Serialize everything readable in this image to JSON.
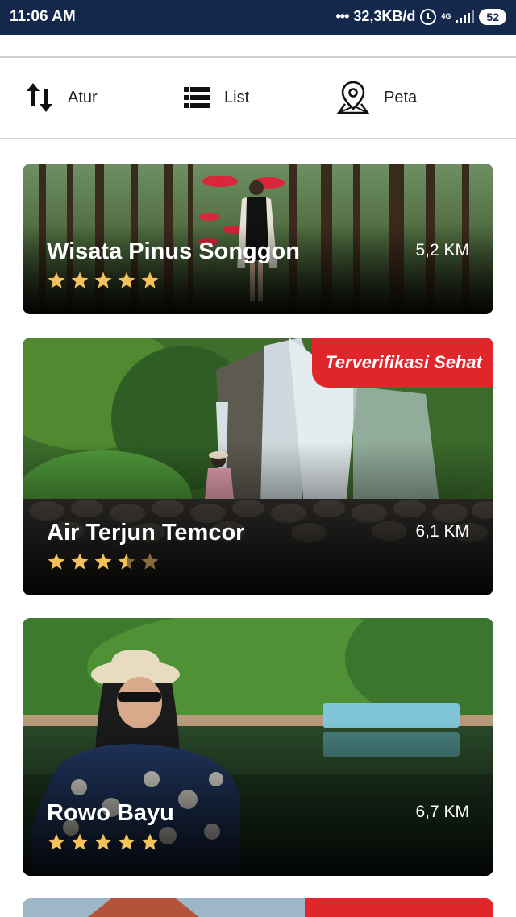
{
  "status_bar": {
    "time": "11:06 AM",
    "network_speed": "32,3KB/d",
    "network_type": "4G",
    "battery": "52"
  },
  "toolbar": {
    "sort": {
      "label": "Atur",
      "icon": "sort-arrows-icon"
    },
    "list": {
      "label": "List",
      "icon": "list-icon"
    },
    "map": {
      "label": "Peta",
      "icon": "map-pin-icon"
    }
  },
  "places": [
    {
      "name": "Wisata Pinus Songgon",
      "distance": "5,2 KM",
      "rating": 5,
      "badge": ""
    },
    {
      "name": "Air Terjun Temcor",
      "distance": "6,1 KM",
      "rating": 3.5,
      "badge": "Terverifikasi Sehat"
    },
    {
      "name": "Rowo Bayu",
      "distance": "6,7 KM",
      "rating": 5,
      "badge": ""
    }
  ],
  "colors": {
    "status_bar": "#14284b",
    "badge": "#e0262b",
    "star_filled": "#f5c15a",
    "star_empty": "#8a6a3a"
  }
}
